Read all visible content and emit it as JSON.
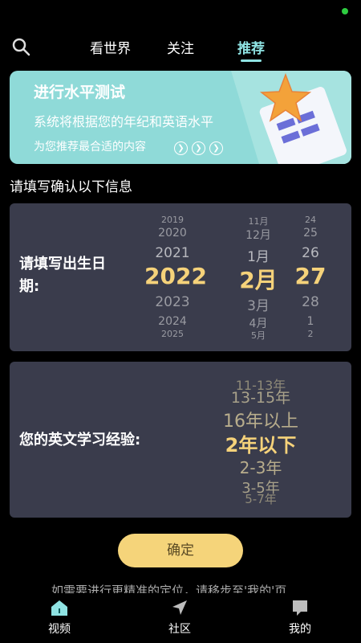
{
  "top_tabs": {
    "tab1": "看世界",
    "tab2": "关注",
    "tab3": "推荐",
    "active": "推荐"
  },
  "banner": {
    "title": "进行水平测试",
    "subtitle": "系统将根据您的年纪和英语水平",
    "subtitle2": "为您推荐最合适的内容"
  },
  "info_label": "请填写确认以下信息",
  "birth": {
    "label": "请填写出生日期:",
    "years": [
      "2019",
      "2020",
      "2021",
      "2022",
      "2023",
      "2024",
      "2025"
    ],
    "months": [
      "11月",
      "12月",
      "1月",
      "2月",
      "3月",
      "4月",
      "5月"
    ],
    "days": [
      "24",
      "25",
      "26",
      "27",
      "28",
      "1",
      "2"
    ],
    "selected": {
      "year": "2022",
      "month": "2月",
      "day": "27"
    }
  },
  "experience": {
    "label": "您的英文学习经验:",
    "options": [
      "11-13年",
      "13-15年",
      "16年以上",
      "2年以下",
      "2-3年",
      "3-5年",
      "5-7年"
    ],
    "selected": "2年以下"
  },
  "confirm_label": "确定",
  "hint": "如需要进行更精准的定位，请移步至'我的'页",
  "bottom_nav": {
    "home": "视频",
    "community": "社区",
    "mine": "我的"
  },
  "colors": {
    "accent": "#8fe3e3",
    "banner": "#8fdad8",
    "card": "#3a3c4c",
    "selected_value": "#f5d27a",
    "confirm_button": "#f5d47a"
  }
}
